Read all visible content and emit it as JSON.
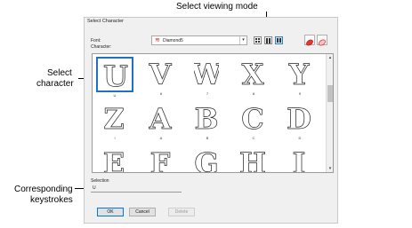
{
  "callouts": {
    "viewing_mode": "Select viewing mode",
    "select_character_line1": "Select",
    "select_character_line2": "character",
    "keystrokes_line1": "Corresponding",
    "keystrokes_line2": "keystrokes"
  },
  "dialog": {
    "title": "Select Character",
    "font_label": "Font:",
    "character_label": "Character:",
    "font_value": "Diamond5",
    "font_icon": "stitch-font-icon",
    "view_modes": [
      "small-icons-view-icon",
      "medium-icons-view-icon",
      "large-icons-view-icon"
    ],
    "active_view_mode": "large-icons-view-icon",
    "tool_icons": [
      "lettering-object-icon",
      "lettering-outline-icon"
    ],
    "selection_label": "Selection",
    "selection_value": "U",
    "ok_label": "OK",
    "cancel_label": "Cancel",
    "delete_label": "Delete",
    "selected_color": "#1e73be"
  },
  "characters": [
    {
      "glyph": "U",
      "label": "U",
      "selected": true
    },
    {
      "glyph": "V",
      "label": "6"
    },
    {
      "glyph": "W",
      "label": "7"
    },
    {
      "glyph": "X",
      "label": "8"
    },
    {
      "glyph": "Y",
      "label": "9"
    },
    {
      "glyph": "Z",
      "label": "!"
    },
    {
      "glyph": "A",
      "label": "A"
    },
    {
      "glyph": "B",
      "label": "B"
    },
    {
      "glyph": "C",
      "label": "C"
    },
    {
      "glyph": "D",
      "label": "D"
    },
    {
      "glyph": "E",
      "label": ""
    },
    {
      "glyph": "F",
      "label": ""
    },
    {
      "glyph": "G",
      "label": ""
    },
    {
      "glyph": "H",
      "label": ""
    },
    {
      "glyph": "I",
      "label": ""
    }
  ]
}
